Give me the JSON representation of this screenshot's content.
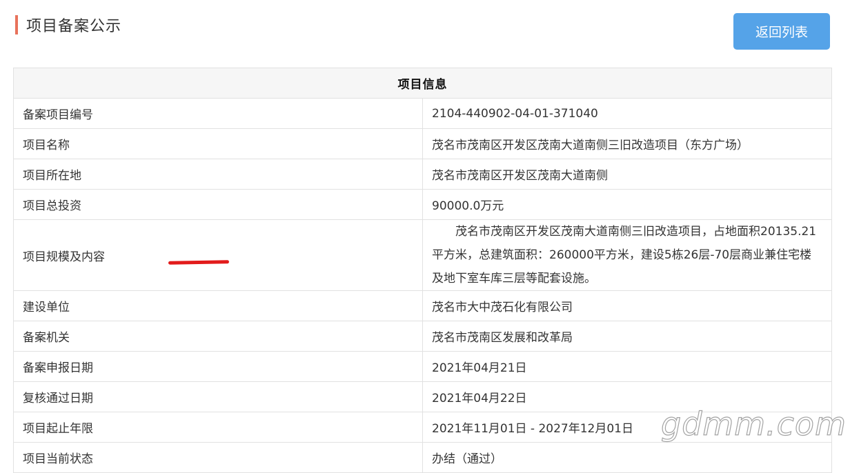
{
  "header": {
    "title": "项目备案公示",
    "back_label": "返回列表",
    "accent_color": "#e8725b",
    "button_color": "#55a3e8"
  },
  "table": {
    "caption": "项目信息",
    "rows": [
      {
        "label": "备案项目编号",
        "value": "2104-440902-04-01-371040"
      },
      {
        "label": "项目名称",
        "value": "茂名市茂南区开发区茂南大道南侧三旧改造项目（东方广场）"
      },
      {
        "label": "项目所在地",
        "value": "茂名市茂南区开发区茂南大道南侧"
      },
      {
        "label": "项目总投资",
        "value": "90000.0万元"
      },
      {
        "label": "项目规模及内容",
        "value": "茂名市茂南区开发区茂南大道南侧三旧改造项目，占地面积20135.21平方米，总建筑面积：260000平方米，建设5栋26层-70层商业兼住宅楼及地下室车库三层等配套设施。"
      },
      {
        "label": "建设单位",
        "value": "茂名市大中茂石化有限公司"
      },
      {
        "label": "备案机关",
        "value": "茂名市茂南区发展和改革局"
      },
      {
        "label": "备案申报日期",
        "value": "2021年04月21日"
      },
      {
        "label": "复核通过日期",
        "value": "2021年04月22日"
      },
      {
        "label": "项目起止年限",
        "value": "2021年11月01日 - 2027年12月01日"
      },
      {
        "label": "项目当前状态",
        "value": "办结（通过）"
      }
    ]
  },
  "watermark": "gdmm.com"
}
